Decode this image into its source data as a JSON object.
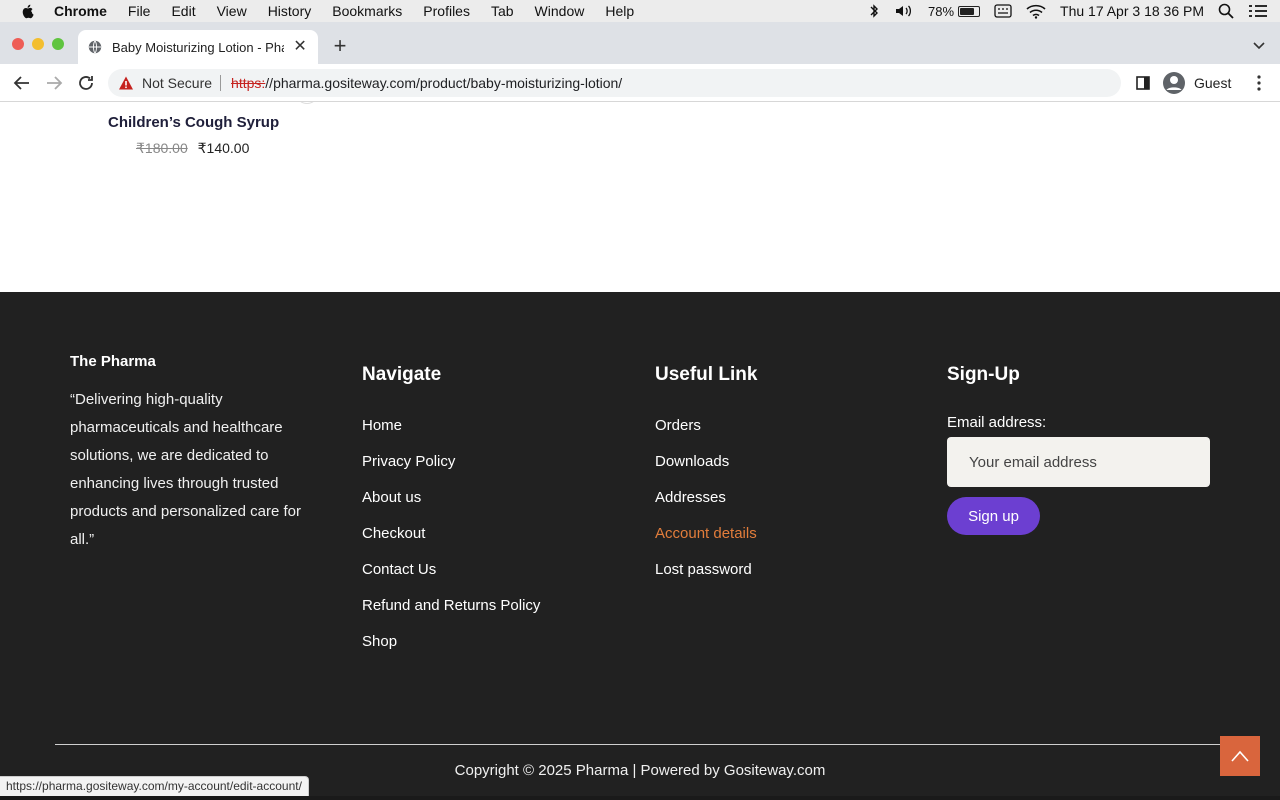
{
  "menubar": {
    "app": "Chrome",
    "items": [
      "File",
      "Edit",
      "View",
      "History",
      "Bookmarks",
      "Profiles",
      "Tab",
      "Window",
      "Help"
    ],
    "battery": "78%",
    "battery_level": 0.78,
    "clock": "Thu 17 Apr  3 18 36 PM",
    "icons": [
      "bluetooth-icon",
      "volume-icon",
      "battery-icon",
      "keyboard-icon",
      "wifi-icon",
      "search-icon",
      "control-center-icon"
    ]
  },
  "browser": {
    "tab_title": "Baby Moisturizing Lotion - Pha",
    "security_label": "Not Secure",
    "url_scheme": "https:",
    "url_rest": "//pharma.gositeway.com/product/baby-moisturizing-lotion/",
    "profile_label": "Guest",
    "status_url": "https://pharma.gositeway.com/my-account/edit-account/"
  },
  "product": {
    "name": "Children’s Cough Syrup",
    "old_price": "₹180.00",
    "new_price": "₹140.00"
  },
  "footer": {
    "brand": "The Pharma",
    "quote": "“Delivering high-quality pharmaceuticals and healthcare solutions, we are dedicated to enhancing lives through trusted products and personalized care for all.”",
    "navigate": {
      "heading": "Navigate",
      "links": [
        "Home",
        "Privacy Policy",
        "About us",
        "Checkout",
        "Contact Us",
        "Refund and Returns Policy",
        "Shop"
      ]
    },
    "useful": {
      "heading": "Useful Link",
      "links": [
        "Orders",
        "Downloads",
        "Addresses",
        "Account details",
        "Lost password"
      ]
    },
    "signup": {
      "heading": "Sign-Up",
      "email_label": "Email address:",
      "email_placeholder": "Your email address",
      "button": "Sign up"
    },
    "copyright": "Copyright © 2025 Pharma | Powered by Gositeway.com"
  },
  "colors": {
    "footer_bg": "#212121",
    "accent_orange": "#e27d3b",
    "signup_purple": "#6c3fd1",
    "back_to_top": "#d9653d"
  }
}
